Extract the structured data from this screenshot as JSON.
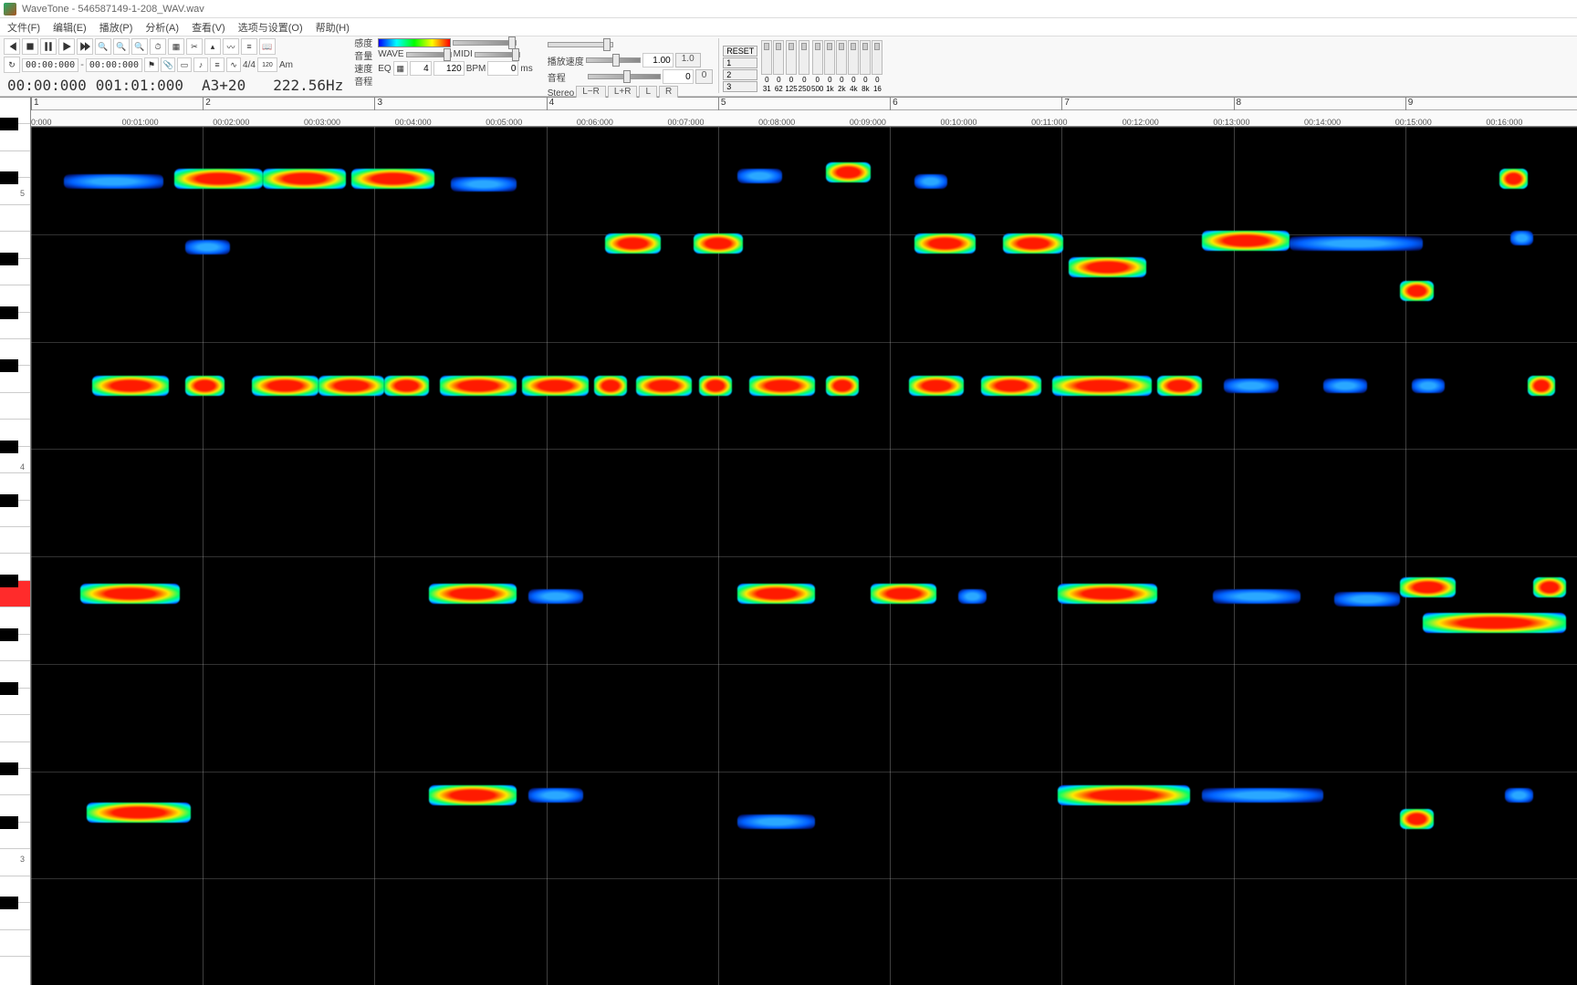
{
  "app": {
    "title": "WaveTone - 546587149-1-208_WAV.wav"
  },
  "menu": {
    "file": "文件(F)",
    "edit": "编辑(E)",
    "play": "播放(P)",
    "analyze": "分析(A)",
    "view": "查看(V)",
    "options": "选项与设置(O)",
    "help": "帮助(H)"
  },
  "transport": {
    "time_start": "00:00:000",
    "time_end": "00:00:000",
    "big_left": "00:00:000",
    "big_right": "001:01:000",
    "note": "A3+20",
    "freq": "222.56Hz",
    "time_sig": "4/4",
    "bpm_label": "120",
    "key": "Am"
  },
  "panel": {
    "labels": {
      "sensitivity": "感度",
      "volume": "音量",
      "speed": "速度",
      "pitch": "音程"
    },
    "wave": "WAVE",
    "midi": "MIDI",
    "playback_speed": "播放速度",
    "speed_value": "1.00",
    "speed_default": "1.0",
    "pitch_label": "音程",
    "pitch_value": "0",
    "pitch_default": "0",
    "eq": "EQ",
    "eq_grid": "4",
    "eq_bpm": "120",
    "bpm": "BPM",
    "bpm_value": "0",
    "ms": "ms",
    "stereo": "Stereo",
    "lminusr": "L−R",
    "lplusr": "L+R",
    "l": "L",
    "r": "R",
    "reset": "RESET"
  },
  "mixer": {
    "nums": [
      "1",
      "2",
      "3"
    ],
    "channels": [
      {
        "v": "0",
        "f": "31"
      },
      {
        "v": "0",
        "f": "62"
      },
      {
        "v": "0",
        "f": "125"
      },
      {
        "v": "0",
        "f": "250"
      },
      {
        "v": "0",
        "f": "500"
      },
      {
        "v": "0",
        "f": "1k"
      },
      {
        "v": "0",
        "f": "2k"
      },
      {
        "v": "0",
        "f": "4k"
      },
      {
        "v": "0",
        "f": "8k"
      },
      {
        "v": "0",
        "f": "16"
      }
    ]
  },
  "ruler": {
    "bars": [
      "1",
      "2",
      "3",
      "4",
      "5",
      "6",
      "7",
      "8",
      "9"
    ],
    "times": [
      "0:000",
      "00:01:000",
      "00:02:000",
      "00:03:000",
      "00:04:000",
      "00:05:000",
      "00:06:000",
      "00:07:000",
      "00:08:000",
      "00:09:000",
      "00:10:000",
      "00:11:000",
      "00:12:000",
      "00:13:000",
      "00:14:000",
      "00:15:000",
      "00:16:000"
    ]
  },
  "piano": {
    "octaves": [
      "5",
      "4",
      "3"
    ]
  }
}
